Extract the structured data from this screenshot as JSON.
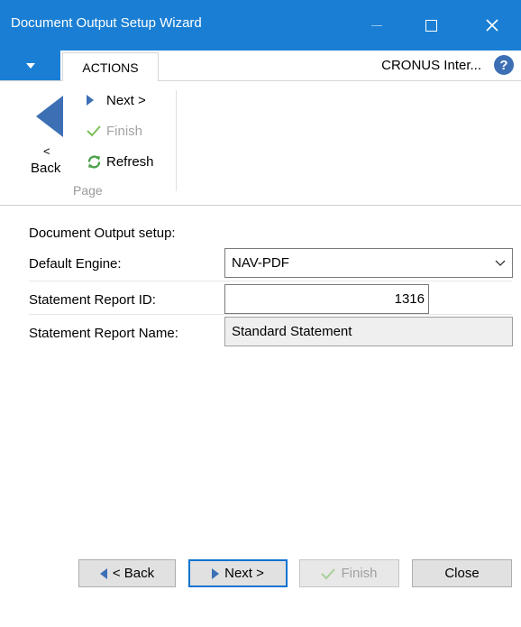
{
  "window": {
    "title": "Document Output Setup Wizard"
  },
  "ribbon": {
    "tab_label": "ACTIONS",
    "company_label": "CRONUS Inter...",
    "help_icon": "?",
    "back_arrow_text": "<",
    "back_label": "Back",
    "next_label": "Next >",
    "finish_label": "Finish",
    "refresh_label": "Refresh",
    "group_label": "Page"
  },
  "form": {
    "caption": "Document Output setup:",
    "default_engine_label": "Default Engine:",
    "default_engine_value": "NAV-PDF",
    "statement_report_id_label": "Statement Report ID:",
    "statement_report_id_value": "1316",
    "statement_report_name_label": "Statement Report Name:",
    "statement_report_name_value": "Standard Statement"
  },
  "buttons": {
    "back": "< Back",
    "next": "Next >",
    "finish": "Finish",
    "close": "Close"
  },
  "colors": {
    "titlebar": "#1a7fd4",
    "accent": "#3d6fb5",
    "finish_check": "#7cc05a",
    "refresh": "#4aa14a",
    "disabled": "#a4a4a4"
  }
}
